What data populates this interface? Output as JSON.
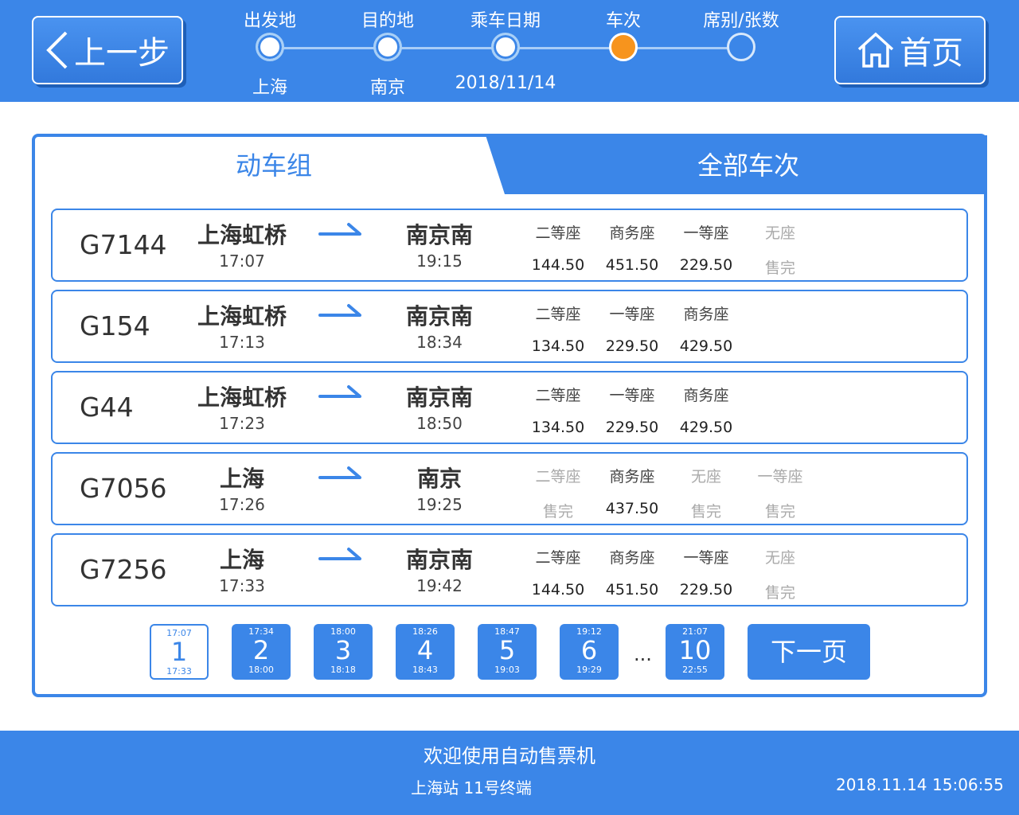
{
  "header": {
    "back_label": "上一步",
    "home_label": "首页",
    "steps": [
      {
        "label": "出发地",
        "value": "上海",
        "state": "done"
      },
      {
        "label": "目的地",
        "value": "南京",
        "state": "done"
      },
      {
        "label": "乘车日期",
        "value": "2018/11/14",
        "state": "done"
      },
      {
        "label": "车次",
        "value": "",
        "state": "current"
      },
      {
        "label": "席别/张数",
        "value": "",
        "state": "todo"
      }
    ]
  },
  "tabs": {
    "left_label": "动车组",
    "right_label": "全部车次"
  },
  "trains": [
    {
      "no": "G7144",
      "from": "上海虹桥",
      "depart": "17:07",
      "to": "南京南",
      "arrive": "19:15",
      "seats": [
        {
          "name": "二等座",
          "price": "144.50",
          "soldout": false
        },
        {
          "name": "商务座",
          "price": "451.50",
          "soldout": false
        },
        {
          "name": "一等座",
          "price": "229.50",
          "soldout": false
        },
        {
          "name": "无座",
          "price": "售完",
          "soldout": true
        }
      ]
    },
    {
      "no": "G154",
      "from": "上海虹桥",
      "depart": "17:13",
      "to": "南京南",
      "arrive": "18:34",
      "seats": [
        {
          "name": "二等座",
          "price": "134.50",
          "soldout": false
        },
        {
          "name": "一等座",
          "price": "229.50",
          "soldout": false
        },
        {
          "name": "商务座",
          "price": "429.50",
          "soldout": false
        }
      ]
    },
    {
      "no": "G44",
      "from": "上海虹桥",
      "depart": "17:23",
      "to": "南京南",
      "arrive": "18:50",
      "seats": [
        {
          "name": "二等座",
          "price": "134.50",
          "soldout": false
        },
        {
          "name": "一等座",
          "price": "229.50",
          "soldout": false
        },
        {
          "name": "商务座",
          "price": "429.50",
          "soldout": false
        }
      ]
    },
    {
      "no": "G7056",
      "from": "上海",
      "depart": "17:26",
      "to": "南京",
      "arrive": "19:25",
      "seats": [
        {
          "name": "二等座",
          "price": "售完",
          "soldout": true
        },
        {
          "name": "商务座",
          "price": "437.50",
          "soldout": false
        },
        {
          "name": "无座",
          "price": "售完",
          "soldout": true
        },
        {
          "name": "一等座",
          "price": "售完",
          "soldout": true
        }
      ]
    },
    {
      "no": "G7256",
      "from": "上海",
      "depart": "17:33",
      "to": "南京南",
      "arrive": "19:42",
      "seats": [
        {
          "name": "二等座",
          "price": "144.50",
          "soldout": false
        },
        {
          "name": "商务座",
          "price": "451.50",
          "soldout": false
        },
        {
          "name": "一等座",
          "price": "229.50",
          "soldout": false
        },
        {
          "name": "无座",
          "price": "售完",
          "soldout": true
        }
      ]
    }
  ],
  "pagination": {
    "pages": [
      {
        "num": "1",
        "start": "17:07",
        "end": "17:33",
        "active": true
      },
      {
        "num": "2",
        "start": "17:34",
        "end": "18:00",
        "active": false
      },
      {
        "num": "3",
        "start": "18:00",
        "end": "18:18",
        "active": false
      },
      {
        "num": "4",
        "start": "18:26",
        "end": "18:43",
        "active": false
      },
      {
        "num": "5",
        "start": "18:47",
        "end": "19:03",
        "active": false
      },
      {
        "num": "6",
        "start": "19:12",
        "end": "19:29",
        "active": false
      },
      {
        "num": "10",
        "start": "21:07",
        "end": "22:55",
        "active": false
      }
    ],
    "ellipsis": "...",
    "next_label": "下一页"
  },
  "footer": {
    "welcome": "欢迎使用自动售票机",
    "station": "上海站 11号终端",
    "date": "2018.11.14",
    "time": "15:06:55"
  },
  "colors": {
    "primary": "#3b86e8",
    "current_step": "#f7941d",
    "soldout_text": "#aaaaaa"
  }
}
